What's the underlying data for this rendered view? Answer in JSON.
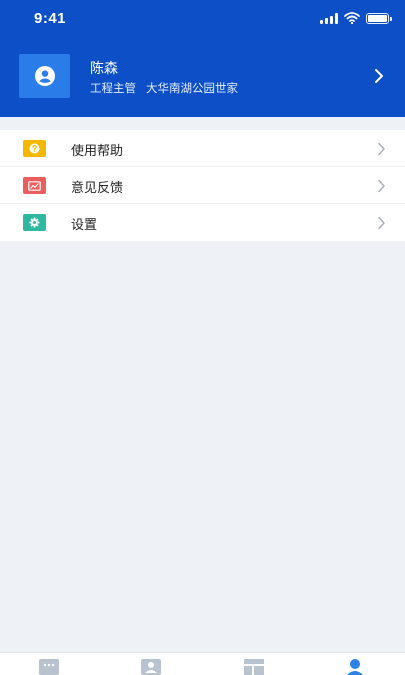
{
  "status_bar": {
    "time": "9:41"
  },
  "profile": {
    "name": "陈森",
    "role": "工程主管",
    "project": "大华南湖公园世家",
    "avatar_icon": "user-avatar-icon"
  },
  "menu": {
    "items": [
      {
        "label": "使用帮助",
        "icon": "help-icon",
        "color": "#f5b800"
      },
      {
        "label": "意见反馈",
        "icon": "feedback-icon",
        "color": "#ea5e5e"
      },
      {
        "label": "设置",
        "icon": "gear-icon",
        "color": "#2fb8a0"
      }
    ]
  },
  "tabbar": {
    "tabs": [
      {
        "icon": "message-icon",
        "active": false
      },
      {
        "icon": "contacts-icon",
        "active": false
      },
      {
        "icon": "workbench-icon",
        "active": false
      },
      {
        "icon": "profile-icon",
        "active": true
      }
    ]
  },
  "colors": {
    "header": "#0d4fc7",
    "active_tab": "#2b82e6",
    "inactive_tab": "#b9c3cf"
  }
}
